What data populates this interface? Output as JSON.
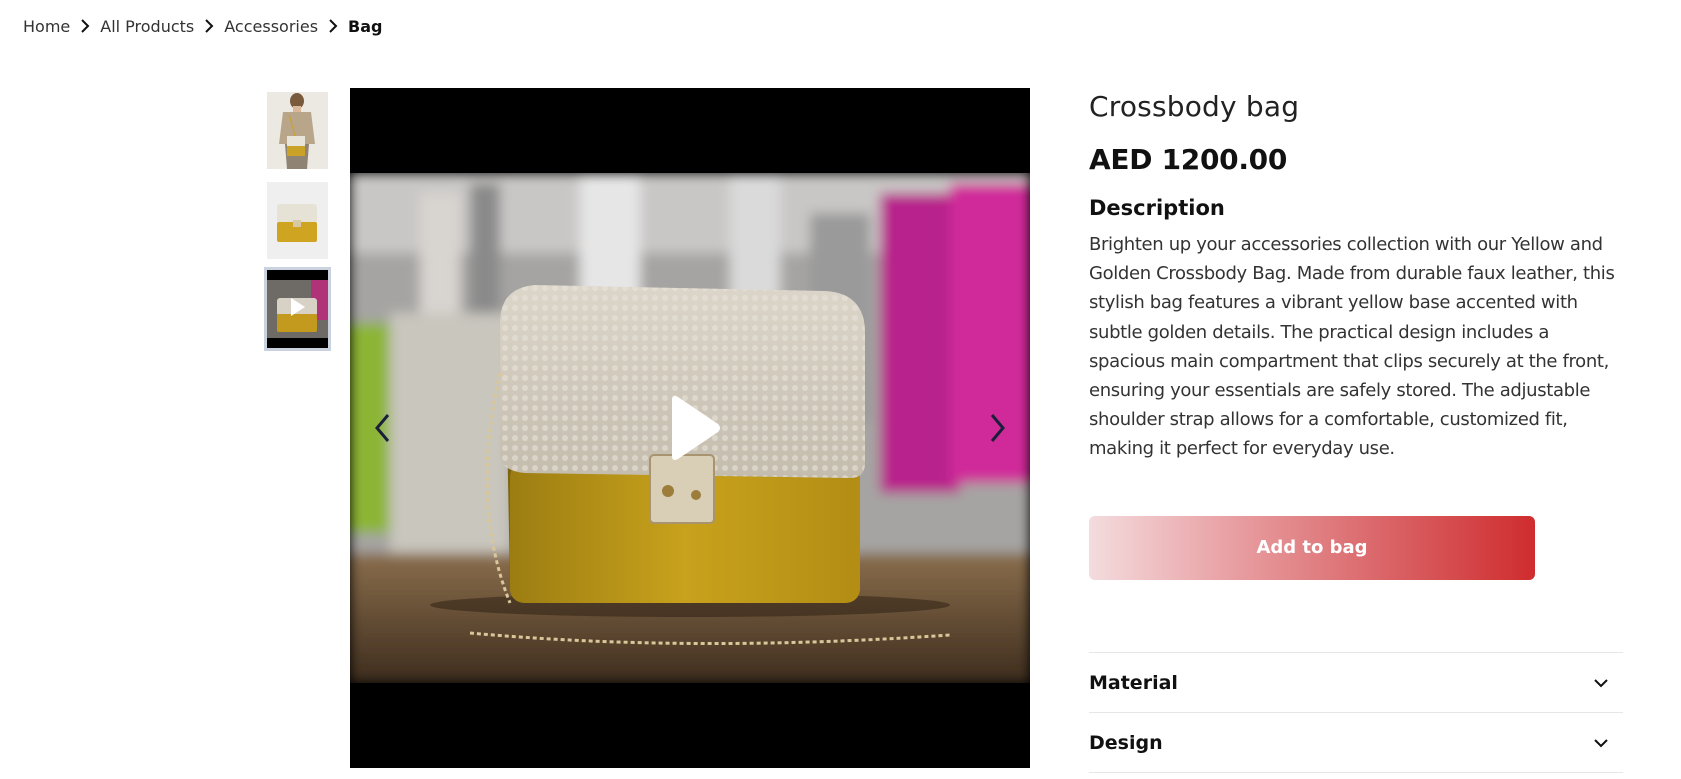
{
  "breadcrumb": {
    "items": [
      "Home",
      "All Products",
      "Accessories"
    ],
    "current": "Bag"
  },
  "gallery": {
    "thumbnails": [
      "model-wearing-bag",
      "bag-product-shot",
      "bag-video"
    ],
    "selected_thumbnail": "bag-video",
    "media_type": "video"
  },
  "product": {
    "title": "Crossbody bag",
    "price": "AED 1200.00",
    "description_heading": "Description",
    "description": "Brighten up your accessories collection with our Yellow and Golden Crossbody Bag. Made from durable faux leather, this stylish bag features a vibrant yellow base accented with subtle golden details. The practical design includes a spacious main compartment that clips securely at the front, ensuring your essentials are safely stored. The adjustable shoulder strap allows for a comfortable, customized fit, making it perfect for everyday use.",
    "add_to_bag_label": "Add to bag"
  },
  "accordion": {
    "items": [
      "Material",
      "Design"
    ]
  },
  "colors": {
    "button_gradient_start": "#f4dcde",
    "button_gradient_end": "#cf2c2e",
    "thumb_selected_border": "#c9d2de"
  },
  "icons": {
    "breadcrumb_separator": "chevron-right-icon",
    "prev": "chevron-left-icon",
    "next": "chevron-right-icon",
    "play": "play-icon",
    "accordion": "chevron-down-icon"
  }
}
